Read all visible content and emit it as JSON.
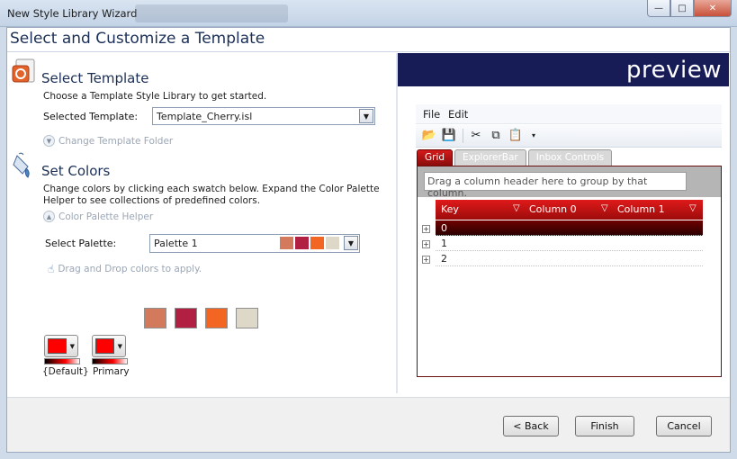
{
  "window": {
    "title": "New Style Library Wizard",
    "minimize": "—",
    "maximize": "□",
    "close": "✕"
  },
  "page_title": "Select and Customize a Template",
  "select_template": {
    "title": "Select Template",
    "description": "Choose a Template Style Library to get started.",
    "field_label": "Selected Template:",
    "value": "Template_Cherry.isl",
    "change_folder_link": "Change Template Folder"
  },
  "set_colors": {
    "title": "Set Colors",
    "description_line1": "Change colors by clicking each swatch below. Expand the Color Palette",
    "description_line2": "Helper to see collections of predefined colors.",
    "palette_helper_link": "Color Palette Helper",
    "palette_label": "Select Palette:",
    "palette_value": "Palette 1",
    "palette_colors": [
      "#d47a5c",
      "#b11f43",
      "#f26522",
      "#ddd8c8"
    ],
    "drag_hint": "Drag and Drop colors to apply.",
    "color_buttons": [
      {
        "caption": "{Default}",
        "color": "#ff0000"
      },
      {
        "caption": "Primary",
        "color": "#ff0000"
      }
    ]
  },
  "preview": {
    "banner": "preview",
    "menu": [
      "File",
      "Edit"
    ],
    "tabs": [
      "Grid",
      "ExplorerBar",
      "Inbox Controls"
    ],
    "group_hint": "Drag a column header here to group by that column.",
    "columns": [
      "Key",
      "Column 0",
      "Column 1"
    ],
    "rows": [
      "0",
      "1",
      "2"
    ],
    "accent": "#c40000"
  },
  "footer": {
    "back": "< Back",
    "finish": "Finish",
    "cancel": "Cancel"
  }
}
